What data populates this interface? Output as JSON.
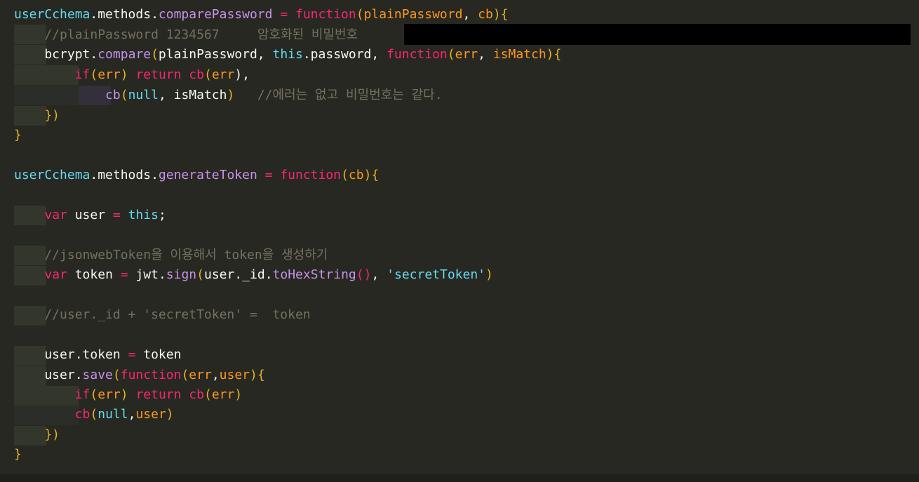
{
  "editor": {
    "lines": [
      {
        "tokens": [
          {
            "t": "userCchema",
            "c": "c-lightblue"
          },
          {
            "t": ".methods.",
            "c": "c-white"
          },
          {
            "t": "comparePassword",
            "c": "c-purple"
          },
          {
            "t": " = ",
            "c": "c-pink"
          },
          {
            "t": "function",
            "c": "c-pink"
          },
          {
            "t": "(",
            "c": "c-paren"
          },
          {
            "t": "plainPassword",
            "c": "c-orange"
          },
          {
            "t": ", ",
            "c": "c-white"
          },
          {
            "t": "cb",
            "c": "c-orange"
          },
          {
            "t": "){",
            "c": "c-paren"
          }
        ]
      },
      {
        "tokens": [
          {
            "t": "    //plainPassword 1234567     암호화된 비밀번호",
            "c": "c-gray"
          }
        ]
      },
      {
        "tokens": [
          {
            "t": "    bcrypt.",
            "c": "c-white"
          },
          {
            "t": "compare",
            "c": "c-purple"
          },
          {
            "t": "(",
            "c": "c-paren"
          },
          {
            "t": "plainPassword, ",
            "c": "c-white"
          },
          {
            "t": "this",
            "c": "c-lightblue"
          },
          {
            "t": ".password, ",
            "c": "c-white"
          },
          {
            "t": "function",
            "c": "c-pink"
          },
          {
            "t": "(",
            "c": "c-paren"
          },
          {
            "t": "err",
            "c": "c-orange"
          },
          {
            "t": ", ",
            "c": "c-white"
          },
          {
            "t": "isMatch",
            "c": "c-orange"
          },
          {
            "t": "){",
            "c": "c-paren"
          }
        ]
      },
      {
        "tokens": [
          {
            "t": "        ",
            "c": "c-white"
          },
          {
            "t": "if",
            "c": "c-pink"
          },
          {
            "t": "(",
            "c": "c-paren"
          },
          {
            "t": "err",
            "c": "c-orange"
          },
          {
            "t": ") ",
            "c": "c-paren"
          },
          {
            "t": "return ",
            "c": "c-pink"
          },
          {
            "t": "cb",
            "c": "c-pink"
          },
          {
            "t": "(",
            "c": "c-paren"
          },
          {
            "t": "err",
            "c": "c-orange"
          },
          {
            "t": "),",
            "c": "c-white"
          }
        ]
      },
      {
        "tokens": [
          {
            "t": "            ",
            "c": "c-white"
          },
          {
            "t": "cb",
            "c": "c-purple"
          },
          {
            "t": "(",
            "c": "c-paren"
          },
          {
            "t": "null",
            "c": "c-lightblue"
          },
          {
            "t": ", isMatch",
            "c": "c-white"
          },
          {
            "t": ")",
            "c": "c-paren"
          },
          {
            "t": "   //에러는 없고 비밀번호는 같다.",
            "c": "c-gray"
          }
        ]
      },
      {
        "tokens": [
          {
            "t": "    })",
            "c": "c-paren"
          }
        ]
      },
      {
        "tokens": [
          {
            "t": "}",
            "c": "c-paren"
          }
        ]
      },
      {
        "tokens": [
          {
            "t": "",
            "c": "c-white"
          }
        ]
      },
      {
        "tokens": [
          {
            "t": "userCchema",
            "c": "c-lightblue"
          },
          {
            "t": ".methods.",
            "c": "c-white"
          },
          {
            "t": "generateToken",
            "c": "c-purple"
          },
          {
            "t": " = ",
            "c": "c-pink"
          },
          {
            "t": "function",
            "c": "c-pink"
          },
          {
            "t": "(",
            "c": "c-paren"
          },
          {
            "t": "cb",
            "c": "c-orange"
          },
          {
            "t": "){",
            "c": "c-paren"
          }
        ]
      },
      {
        "tokens": [
          {
            "t": "",
            "c": "c-white"
          }
        ]
      },
      {
        "tokens": [
          {
            "t": "    ",
            "c": "c-white"
          },
          {
            "t": "var ",
            "c": "c-pink"
          },
          {
            "t": "user ",
            "c": "c-white"
          },
          {
            "t": "= ",
            "c": "c-pink"
          },
          {
            "t": "this",
            "c": "c-lightblue"
          },
          {
            "t": ";",
            "c": "c-white"
          }
        ]
      },
      {
        "tokens": [
          {
            "t": "",
            "c": "c-white"
          }
        ]
      },
      {
        "tokens": [
          {
            "t": "    //jsonwebToken을 이용해서 token을 생성하기",
            "c": "c-gray"
          }
        ]
      },
      {
        "tokens": [
          {
            "t": "    ",
            "c": "c-white"
          },
          {
            "t": "var ",
            "c": "c-pink"
          },
          {
            "t": "token ",
            "c": "c-white"
          },
          {
            "t": "= ",
            "c": "c-pink"
          },
          {
            "t": "jwt.",
            "c": "c-white"
          },
          {
            "t": "sign",
            "c": "c-purple"
          },
          {
            "t": "(",
            "c": "c-paren"
          },
          {
            "t": "user._id.",
            "c": "c-white"
          },
          {
            "t": "toHexString",
            "c": "c-purple"
          },
          {
            "t": "()",
            "c": "c-pink"
          },
          {
            "t": ", ",
            "c": "c-white"
          },
          {
            "t": "'secretToken'",
            "c": "c-lightblue"
          },
          {
            "t": ")",
            "c": "c-paren"
          }
        ]
      },
      {
        "tokens": [
          {
            "t": "",
            "c": "c-white"
          }
        ]
      },
      {
        "tokens": [
          {
            "t": "    //user._id + 'secretToken' =  token",
            "c": "c-gray"
          }
        ]
      },
      {
        "tokens": [
          {
            "t": "",
            "c": "c-white"
          }
        ]
      },
      {
        "tokens": [
          {
            "t": "    user.token ",
            "c": "c-white"
          },
          {
            "t": "= ",
            "c": "c-pink"
          },
          {
            "t": "token",
            "c": "c-white"
          }
        ]
      },
      {
        "tokens": [
          {
            "t": "    user.",
            "c": "c-white"
          },
          {
            "t": "save",
            "c": "c-purple"
          },
          {
            "t": "(",
            "c": "c-paren"
          },
          {
            "t": "function",
            "c": "c-pink"
          },
          {
            "t": "(",
            "c": "c-paren"
          },
          {
            "t": "err",
            "c": "c-orange"
          },
          {
            "t": ",",
            "c": "c-white"
          },
          {
            "t": "user",
            "c": "c-orange"
          },
          {
            "t": "){",
            "c": "c-paren"
          }
        ]
      },
      {
        "tokens": [
          {
            "t": "        ",
            "c": "c-white"
          },
          {
            "t": "if",
            "c": "c-pink"
          },
          {
            "t": "(",
            "c": "c-paren"
          },
          {
            "t": "err",
            "c": "c-orange"
          },
          {
            "t": ") ",
            "c": "c-paren"
          },
          {
            "t": "return ",
            "c": "c-pink"
          },
          {
            "t": "cb",
            "c": "c-pink"
          },
          {
            "t": "(",
            "c": "c-paren"
          },
          {
            "t": "err",
            "c": "c-orange"
          },
          {
            "t": ")",
            "c": "c-paren"
          }
        ]
      },
      {
        "tokens": [
          {
            "t": "        ",
            "c": "c-white"
          },
          {
            "t": "cb",
            "c": "c-pink"
          },
          {
            "t": "(",
            "c": "c-paren"
          },
          {
            "t": "null",
            "c": "c-lightblue"
          },
          {
            "t": ",",
            "c": "c-white"
          },
          {
            "t": "user",
            "c": "c-orange"
          },
          {
            "t": ")",
            "c": "c-paren"
          }
        ]
      },
      {
        "tokens": [
          {
            "t": "    })",
            "c": "c-paren"
          }
        ]
      },
      {
        "tokens": [
          {
            "t": "}",
            "c": "c-paren"
          }
        ]
      }
    ]
  }
}
